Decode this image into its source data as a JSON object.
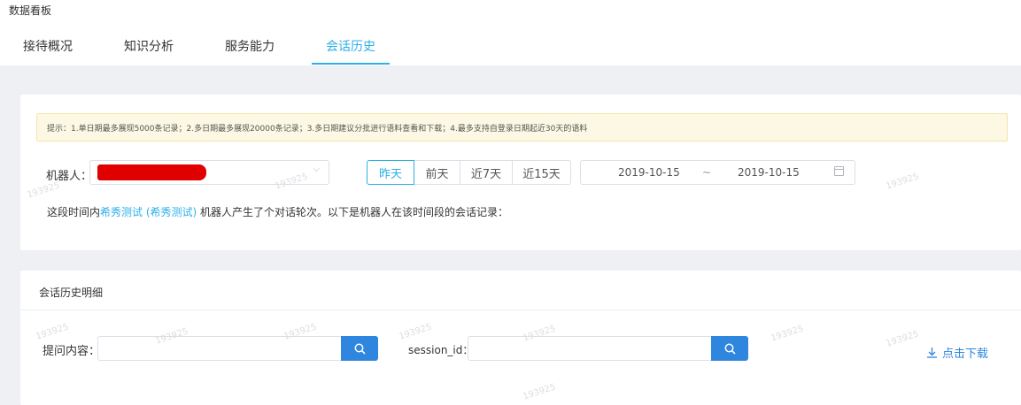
{
  "page": {
    "title": "数据看板"
  },
  "tabs": [
    {
      "label": "接待概况",
      "active": false
    },
    {
      "label": "知识分析",
      "active": false
    },
    {
      "label": "服务能力",
      "active": false
    },
    {
      "label": "会话历史",
      "active": true
    }
  ],
  "notice": {
    "text": "提示：1.单日期最多展现5000条记录；2.多日期最多展现20000条记录；3.多日期建议分批进行语料查看和下载；4.最多支持自登录日期起近30天的语料"
  },
  "filters": {
    "robot_label": "机器人：",
    "range_buttons": [
      "昨天",
      "前天",
      "近7天",
      "近15天"
    ],
    "active_range": "昨天",
    "date_start": "2019-10-15",
    "date_separator": "~",
    "date_end": "2019-10-15"
  },
  "summary": {
    "prefix": "这段时间内",
    "robot_name": "希秀测试 (希秀测试)",
    "suffix": " 机器人产生了个对话轮次。以下是机器人在该时间段的会话记录："
  },
  "history": {
    "title": "会话历史明细",
    "question_label": "提问内容：",
    "question_value": "",
    "session_label": "session_id：",
    "session_value": "",
    "download_label": "点击下载"
  },
  "watermark_text": "193925",
  "colors": {
    "accent": "#2bb0e6",
    "button": "#2e86de",
    "notice_bg": "#fcf8e3",
    "redaction": "#e00000"
  }
}
